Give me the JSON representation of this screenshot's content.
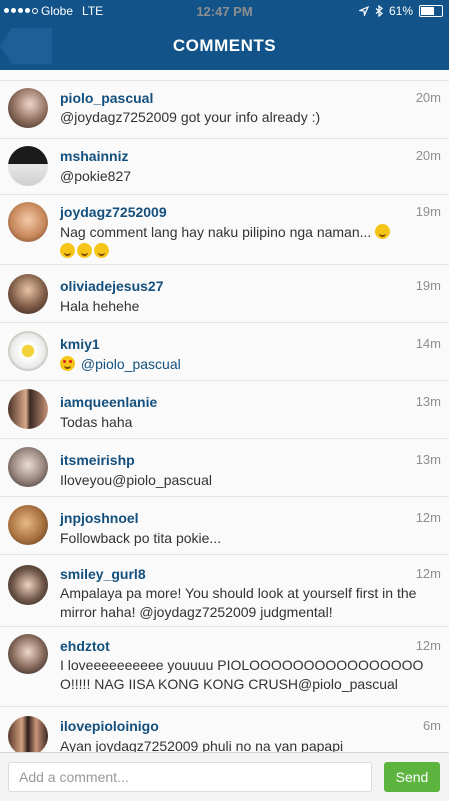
{
  "status_bar": {
    "carrier": "Globe",
    "network": "LTE",
    "time": "12:47 PM",
    "battery": "61%",
    "location_icon": "location-arrow-icon",
    "bluetooth_icon": "bluetooth-icon"
  },
  "header": {
    "title": "COMMENTS",
    "back_icon": "back-arrow-icon"
  },
  "comments": [
    {
      "user": "piolo_pascual",
      "time": "20m",
      "text": "@joydagz7252009 got your info already :)"
    },
    {
      "user": "mshainniz",
      "time": "20m",
      "text": "@pokie827"
    },
    {
      "user": "joydagz7252009",
      "time": "19m",
      "text": "Nag comment lang hay naku pilipino nga naman..."
    },
    {
      "user": "oliviadejesus27",
      "time": "19m",
      "text": "Hala hehehe"
    },
    {
      "user": "kmiy1",
      "time": "14m",
      "text": "@piolo_pascual"
    },
    {
      "user": "iamqueenlanie",
      "time": "13m",
      "text": "Todas haha"
    },
    {
      "user": "itsmeirishp",
      "time": "13m",
      "text": "Iloveyou@piolo_pascual"
    },
    {
      "user": "jnpjoshnoel",
      "time": "12m",
      "text": "Followback po tita pokie..."
    },
    {
      "user": "smiley_gurl8",
      "time": "12m",
      "text": "Ampalaya pa more! You should look at yourself first in the mirror haha! @joydagz7252009 judgmental!"
    },
    {
      "user": "ehdztot",
      "time": "12m",
      "text": "I loveeeeeeeeee youuuu PIOLOOOOOOOOOOOOOOOOO!!!!! NAG IISA KONG KONG CRUSH@piolo_pascual"
    },
    {
      "user": "ilovepioloinigo",
      "time": "6m",
      "text": "Ayan joydagz7252009 phuli no na yan papapi"
    }
  ],
  "composer": {
    "placeholder": "Add a comment...",
    "send_label": "Send"
  },
  "colors": {
    "header": "#12548a",
    "username": "#14507e",
    "send": "#5db53f"
  }
}
